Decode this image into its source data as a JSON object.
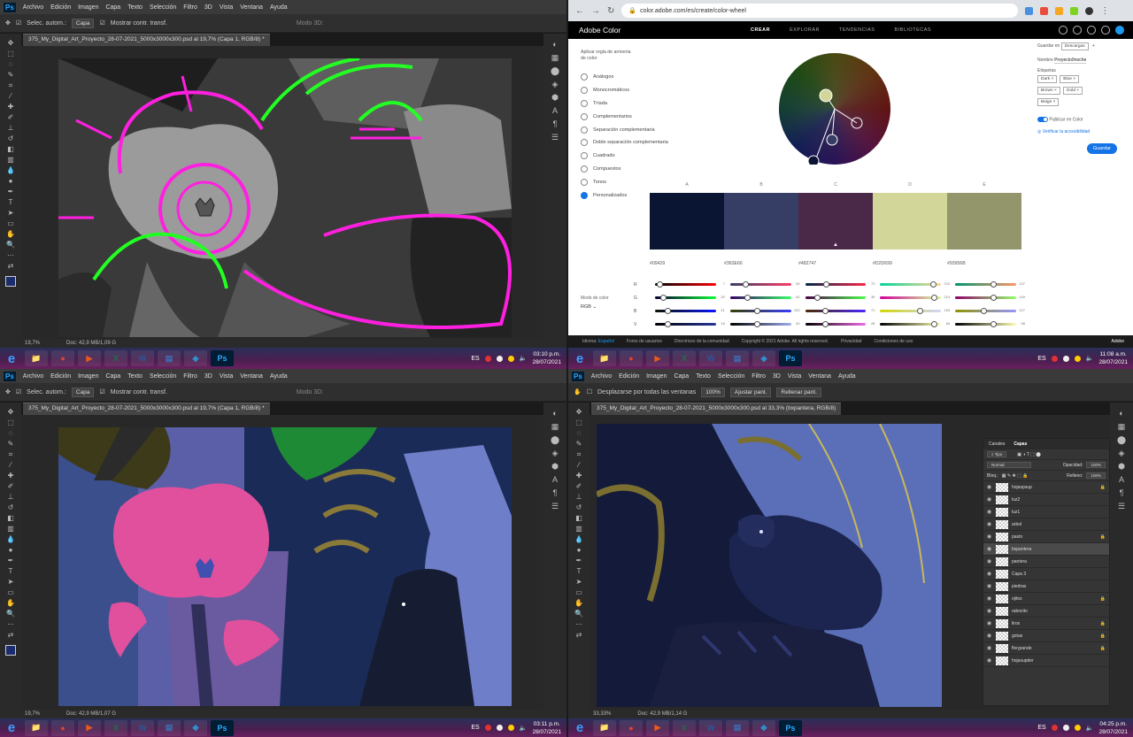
{
  "photoshop": {
    "logo": "Ps",
    "menu": [
      "Archivo",
      "Edición",
      "Imagen",
      "Capa",
      "Texto",
      "Selección",
      "Filtro",
      "3D",
      "Vista",
      "Ventana",
      "Ayuda"
    ],
    "options": {
      "autoselect": "Selec. autom.:",
      "layer": "Capa",
      "transform": "Mostrar contr. transf.",
      "mode3d": "Modo 3D:"
    },
    "options_hand": {
      "scroll_all": "Desplazarse por todas las ventanas",
      "zoom": "100%",
      "fit": "Ajustar pant.",
      "fill": "Rellenar pant."
    },
    "doc_tab_1": "375_My_Digital_Art_Proyecto_28-07-2021_5000x3000x300.psd al 19,7% (Capa 1, RGB/8) *",
    "doc_tab_4": "375_My_Digital_Art_Proyecto_28-07-2021_5000x3000x300.psd al 33,3% (bxpantera, RGB/8)",
    "status_1": {
      "zoom": "19,7%",
      "doc": "Doc: 42,9 MB/1,09 G"
    },
    "status_3": {
      "zoom": "19,7%",
      "doc": "Doc: 42,9 MB/1,07 G"
    },
    "status_4": {
      "zoom": "33,33%",
      "doc": "Doc: 42,9 MB/1,14 G"
    }
  },
  "taskbar": {
    "lang": "ES",
    "clocks": [
      {
        "time": "03:10 p.m.",
        "date": "28/07/2021"
      },
      {
        "time": "11:08 a.m.",
        "date": "28/07/2021"
      },
      {
        "time": "03:11 p.m.",
        "date": "28/07/2021"
      },
      {
        "time": "04:25 p.m.",
        "date": "28/07/2021"
      }
    ],
    "apps": [
      {
        "glyph": "📁",
        "color": "#e8b84a"
      },
      {
        "glyph": "●",
        "color": "#db4437"
      },
      {
        "glyph": "▶",
        "color": "#e65a1e"
      },
      {
        "glyph": "X",
        "color": "#1e7145"
      },
      {
        "glyph": "W",
        "color": "#2b579a"
      },
      {
        "glyph": "▤",
        "color": "#3c6fb5"
      },
      {
        "glyph": "◆",
        "color": "#2f8fcf"
      },
      {
        "glyph": "Ps",
        "color": "#001d34"
      }
    ]
  },
  "chrome": {
    "url": "color.adobe.com/es/create/color-wheel"
  },
  "adobe_color": {
    "brand": "Adobe Color",
    "nav": [
      "CREAR",
      "EXPLORAR",
      "TENDENCIAS",
      "BIBLIOTECAS"
    ],
    "rule_title": "Aplicar regla de armonía de color",
    "rules": [
      "Análogos",
      "Monocromáticos",
      "Tríada",
      "Complementarios",
      "Separación complementaria",
      "Doble separación complementaria",
      "Cuadrado",
      "Compuestos",
      "Tonos",
      "Personalizados"
    ],
    "selected_rule": "Personalizados",
    "swatch_labels": [
      "A",
      "B",
      "C",
      "D",
      "E"
    ],
    "swatches": [
      "#09429",
      "#363E66",
      "#482747",
      "#D2D699",
      "#93956B"
    ],
    "swatch_colors": [
      "#0a1433",
      "#363e66",
      "#4a2848",
      "#d2d699",
      "#93956b"
    ],
    "color_mode_label": "Modo de color",
    "color_mode": "RGB",
    "slider_rows": [
      "R",
      "G",
      "B",
      "V"
    ],
    "slider_values": [
      [
        "7",
        "54",
        "73",
        "210",
        "147"
      ],
      [
        "20",
        "62",
        "39",
        "214",
        "149"
      ],
      [
        "41",
        "102",
        "71",
        "153",
        "107"
      ],
      [
        "16",
        "40",
        "28",
        "84",
        "58"
      ]
    ],
    "save_in_label": "Guardar en",
    "save_in": "Descargas",
    "name_label": "Nombre",
    "name_value": "Proyecto9noche",
    "tags_label": "Etiquetas",
    "tags": [
      "Dark",
      "Blue",
      "Brown",
      "Gold",
      "Beige"
    ],
    "publish": "Publicar en Color",
    "accessibility": "Verificar la accesibilidad",
    "save_button": "Guardar",
    "footer": {
      "lang_label": "Idioma:",
      "lang": "Español",
      "links": [
        "Foros de usuarios",
        "Directrices de la comunidad",
        "Copyright © 2021 Adobe. All rights reserved.",
        "Privacidad",
        "Condiciones de uso"
      ],
      "adobe": "Adobe"
    }
  },
  "layers_panel": {
    "tabs": [
      "Canales",
      "Capas"
    ],
    "kind": "Tipo",
    "blend": "Normal",
    "opacity_label": "Opacidad:",
    "opacity": "100%",
    "lock_label": "Bloq.:",
    "fill_label": "Relleno:",
    "fill": "100%",
    "layers": [
      {
        "name": "hojaspsup",
        "locked": true
      },
      {
        "name": "luz2",
        "locked": false
      },
      {
        "name": "luz1",
        "locked": false
      },
      {
        "name": "arbol",
        "locked": false
      },
      {
        "name": "pasto",
        "locked": true
      },
      {
        "name": "bxpantera",
        "locked": false,
        "selected": true
      },
      {
        "name": "pantera",
        "locked": false
      },
      {
        "name": "Capa 3",
        "locked": false
      },
      {
        "name": "piedras",
        "locked": false
      },
      {
        "name": "ojitos",
        "locked": true
      },
      {
        "name": "rabocito",
        "locked": false
      },
      {
        "name": "liros",
        "locked": true
      },
      {
        "name": "gotas",
        "locked": true
      },
      {
        "name": "florgrande",
        "locked": true
      },
      {
        "name": "hojasupder",
        "locked": false
      }
    ]
  }
}
